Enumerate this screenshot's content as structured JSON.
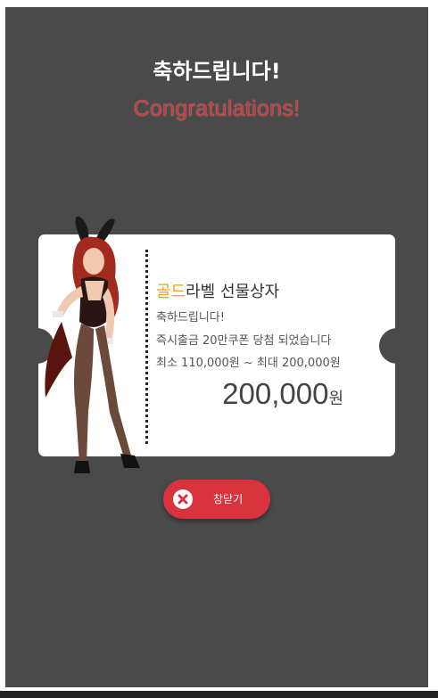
{
  "modal": {
    "title_ko": "축하드립니다!",
    "title_en": "Congratulations!"
  },
  "coupon": {
    "label_highlight": "골드",
    "label_rest": "라벨 선물상자",
    "message_1": "축하드립니다!",
    "message_2": "즉시출금 20만쿠폰 당첨 되었습니다",
    "message_3": "최소 110,000원 ~ 최대 200,000원",
    "amount": "200,000",
    "amount_unit": "원",
    "character_image": "bunny-costume-character"
  },
  "close_button": {
    "label": "창닫기",
    "icon": "close-icon"
  },
  "colors": {
    "modal_bg": "#4a4a4a",
    "accent_red": "#d9333d",
    "title_en": "#c8393f",
    "gold": "#e6a51c"
  }
}
